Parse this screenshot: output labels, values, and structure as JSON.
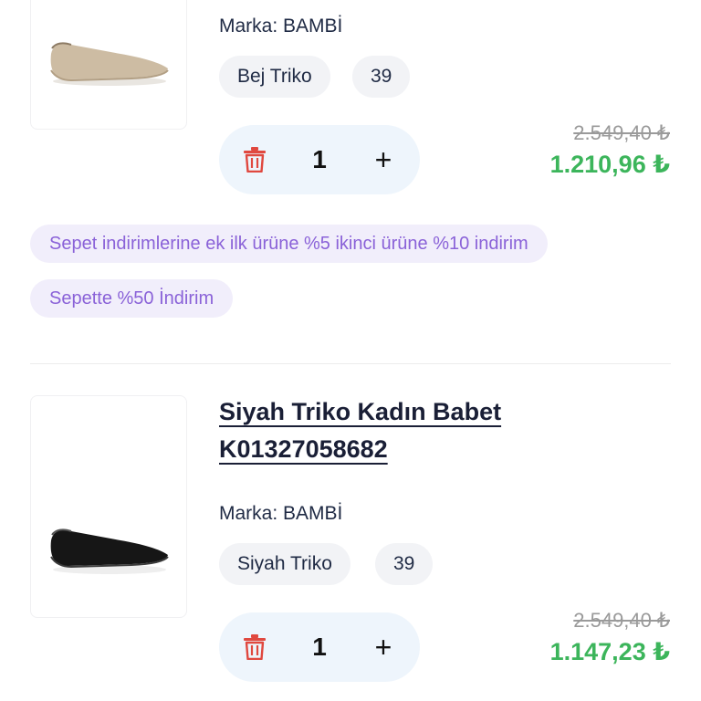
{
  "item1": {
    "brand_label": "Marka:",
    "brand_value": "BAMBİ",
    "color_chip": "Bej Triko",
    "size_chip": "39",
    "quantity": "1",
    "old_price": "2.549,40 ₺",
    "new_price": "1.210,96 ₺",
    "shoe_color": "#cdbca3"
  },
  "promotions": [
    "Sepet indirimlerine ek ilk ürüne %5 ikinci ürüne %10 indirim",
    "Sepette %50 İndirim"
  ],
  "item2": {
    "title_line1": "Siyah Triko Kadın Babet",
    "title_line2": "K01327058682",
    "brand_label": "Marka:",
    "brand_value": "BAMBİ",
    "color_chip": "Siyah Triko",
    "size_chip": "39",
    "quantity": "1",
    "old_price": "2.549,40 ₺",
    "new_price": "1.147,23 ₺",
    "shoe_color": "#161616"
  },
  "colors": {
    "price_green": "#3cb55b",
    "promo_purple": "#8a62d8",
    "trash_red": "#e0483f",
    "quantity_bg": "#eef5fc"
  },
  "icons": {
    "delete": "trash-icon",
    "increase": "plus-icon"
  }
}
